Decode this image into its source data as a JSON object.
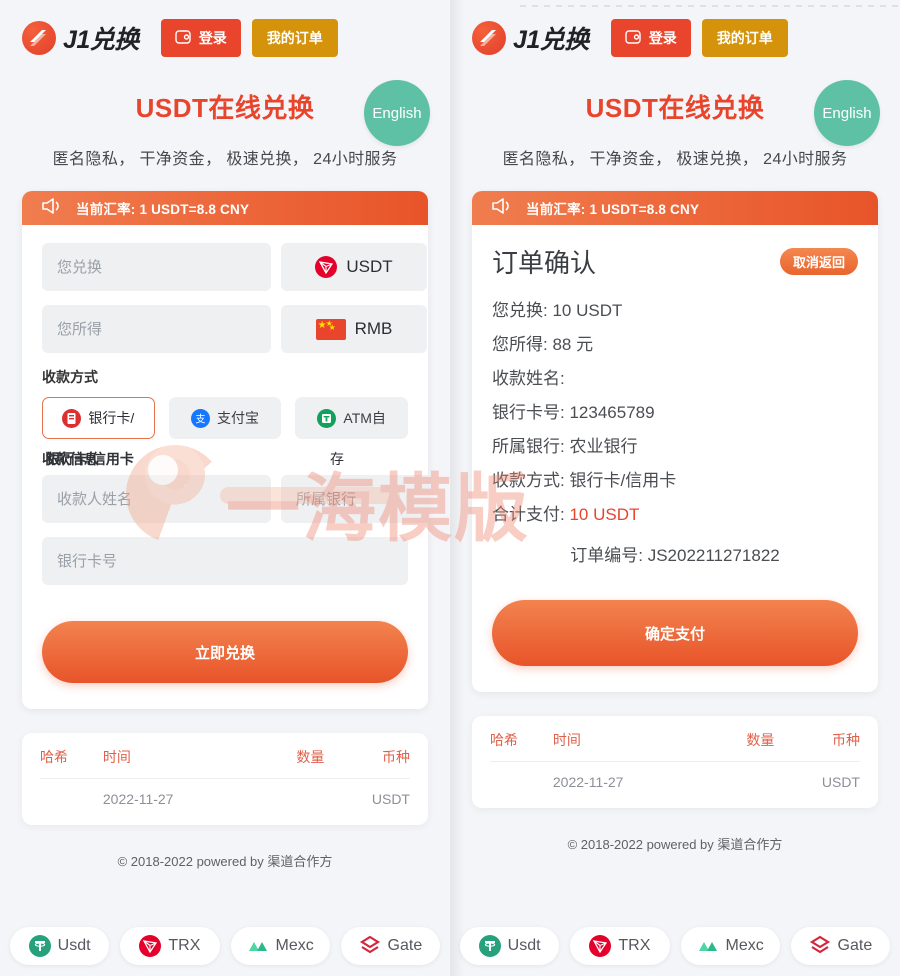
{
  "brand": {
    "logo_text": "J1兑换",
    "logo_icon": "exchange-logo-icon"
  },
  "header": {
    "login_label": "登录",
    "login_icon": "wallet-icon",
    "my_orders_label": "我的订单"
  },
  "hero": {
    "title": "USDT在线兑换",
    "subtitle": "匿名隐私， 干净资金， 极速兑换， 24小时服务",
    "lang_badge": "English"
  },
  "rate_bar": {
    "icon": "megaphone-icon",
    "text": "当前汇率: 1 USDT=8.8 CNY"
  },
  "exchange_form": {
    "send": {
      "placeholder": "您兑换",
      "value": "",
      "coin_label": "USDT",
      "coin_icon": "tron-icon"
    },
    "receive": {
      "placeholder": "您所得",
      "value": "",
      "coin_label": "RMB",
      "coin_icon": "cn-flag-icon"
    },
    "pay_method_label": "收款方式",
    "pay_methods": [
      {
        "label": "银行卡/",
        "icon": "bank-card-icon",
        "active": true
      },
      {
        "label": "支付宝",
        "icon": "alipay-icon",
        "active": false
      },
      {
        "label": "ATM自",
        "icon": "atm-icon",
        "active": false
      }
    ],
    "overlap_labels": {
      "primary": "收款信息",
      "secondary": "银行卡/信用卡",
      "trailing": "存"
    },
    "payee_name": {
      "placeholder": "收款人姓名",
      "value": ""
    },
    "bank_name": {
      "placeholder": "所属银行",
      "value": ""
    },
    "card_no": {
      "placeholder": "银行卡号",
      "value": ""
    },
    "submit_label": "立即兑换"
  },
  "order_confirm": {
    "title": "订单确认",
    "cancel_label": "取消返回",
    "lines": [
      {
        "label": "您兑换:",
        "value": "10 USDT",
        "highlight": false
      },
      {
        "label": "您所得:",
        "value": "88 元",
        "highlight": false
      },
      {
        "label": "收款姓名:",
        "value": "",
        "highlight": false
      },
      {
        "label": "银行卡号:",
        "value": "123465789",
        "highlight": false
      },
      {
        "label": "所属银行:",
        "value": "农业银行",
        "highlight": false
      },
      {
        "label": "收款方式:",
        "value": "银行卡/信用卡",
        "highlight": false
      },
      {
        "label": "合计支付:",
        "value": "10 USDT",
        "highlight": true
      }
    ],
    "order_no_label": "订单编号:",
    "order_no": "JS202211271822",
    "pay_label": "确定支付"
  },
  "history": {
    "columns": [
      "哈希",
      "时间",
      "数量",
      "币种"
    ],
    "rows": [
      {
        "hash": "",
        "time": "2022-11-27",
        "amount": "",
        "coin": "USDT"
      }
    ]
  },
  "footer": {
    "copyright": "© 2018-2022 powered by 渠道合作方",
    "coins": [
      {
        "label": "Usdt",
        "icon": "usdt-icon",
        "color": "#26a17b"
      },
      {
        "label": "TRX",
        "icon": "tron-icon",
        "color": "#e4002b"
      },
      {
        "label": "Mexc",
        "icon": "mexc-icon",
        "color": "#4bd6a2"
      },
      {
        "label": "Gate",
        "icon": "gate-icon",
        "color": "#d3273e"
      }
    ]
  },
  "watermark": {
    "text": "一海模版",
    "logo_icon": "watermark-logo-icon"
  },
  "colors": {
    "accent_red": "#e8452c",
    "accent_orange": "#e8542a",
    "gold": "#d4930a",
    "teal": "#5ec1a5",
    "page_bg": "#f4f5f8"
  }
}
